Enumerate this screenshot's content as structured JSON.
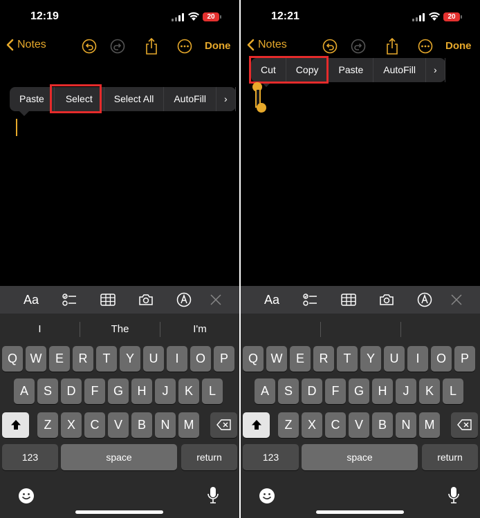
{
  "screens": [
    {
      "status": {
        "time": "12:19",
        "battery": "20"
      },
      "nav": {
        "back_label": "Notes",
        "done_label": "Done"
      },
      "menu": {
        "items": [
          "Paste",
          "Select",
          "Select All",
          "AutoFill"
        ],
        "highlighted": [
          "Select"
        ]
      },
      "keyboard": {
        "toolbar_text": "Aa",
        "suggestions": [
          "I",
          "The",
          "I'm"
        ],
        "row1": [
          "Q",
          "W",
          "E",
          "R",
          "T",
          "Y",
          "U",
          "I",
          "O",
          "P"
        ],
        "row2": [
          "A",
          "S",
          "D",
          "F",
          "G",
          "H",
          "J",
          "K",
          "L"
        ],
        "row3": [
          "Z",
          "X",
          "C",
          "V",
          "B",
          "N",
          "M"
        ],
        "numbers_label": "123",
        "space_label": "space",
        "return_label": "return"
      }
    },
    {
      "status": {
        "time": "12:21",
        "battery": "20"
      },
      "nav": {
        "back_label": "Notes",
        "done_label": "Done"
      },
      "menu": {
        "items": [
          "Cut",
          "Copy",
          "Paste",
          "AutoFill"
        ],
        "highlighted": [
          "Cut",
          "Copy"
        ]
      },
      "keyboard": {
        "toolbar_text": "Aa",
        "suggestions": [
          "",
          "",
          ""
        ],
        "row1": [
          "Q",
          "W",
          "E",
          "R",
          "T",
          "Y",
          "U",
          "I",
          "O",
          "P"
        ],
        "row2": [
          "A",
          "S",
          "D",
          "F",
          "G",
          "H",
          "J",
          "K",
          "L"
        ],
        "row3": [
          "Z",
          "X",
          "C",
          "V",
          "B",
          "N",
          "M"
        ],
        "numbers_label": "123",
        "space_label": "space",
        "return_label": "return"
      }
    }
  ],
  "colors": {
    "accent": "#e7a92b",
    "highlight_box": "#e52b2b",
    "menu_bg": "#2c2c2e",
    "key_bg": "#6b6b6b",
    "keyboard_bg": "#2b2b2b"
  },
  "icons": [
    "chevron-left-icon",
    "undo-icon",
    "redo-icon",
    "share-icon",
    "more-icon",
    "checklist-icon",
    "table-icon",
    "camera-icon",
    "markup-icon",
    "close-icon",
    "shift-icon",
    "delete-icon",
    "emoji-icon",
    "mic-icon"
  ]
}
